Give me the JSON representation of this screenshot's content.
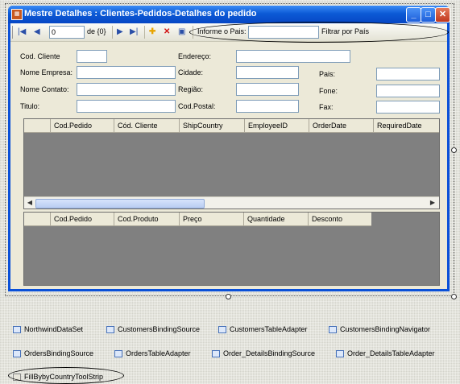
{
  "window": {
    "title": "Mestre Detalhes : Clientes-Pedidos-Detalhes do pedido"
  },
  "titlebar_buttons": {
    "minimize": "_",
    "maximize": "□",
    "close": "✕"
  },
  "toolbar": {
    "position_value": "0",
    "count_label": "de {0}",
    "country_label": "Informe o Pais:",
    "country_value": "",
    "filter_button": "Filtrar por País"
  },
  "form": {
    "cod_cliente": "Cod. Cliente",
    "nome_empresa": "Nome Empresa:",
    "nome_contato": "Nome Contato:",
    "titulo": "Titulo:",
    "endereco": "Endereço:",
    "cidade": "Cidade:",
    "regiao": "Região:",
    "cod_postal": "Cod.Postal:",
    "pais": "Pais:",
    "fone": "Fone:",
    "fax": "Fax:"
  },
  "orders_grid": {
    "columns": [
      "Cod.Pedido",
      "Cód. Cliente",
      "ShipCountry",
      "EmployeeID",
      "OrderDate",
      "RequiredDate"
    ]
  },
  "details_grid": {
    "columns": [
      "Cod.Pedido",
      "Cod.Produto",
      "Preço",
      "Quantidade",
      "Desconto"
    ]
  },
  "component_tray": [
    "NorthwindDataSet",
    "CustomersBindingSource",
    "CustomersTableAdapter",
    "CustomersBindingNavigator",
    "OrdersBindingSource",
    "OrdersTableAdapter",
    "Order_DetailsBindingSource",
    "Order_DetailsTableAdapter",
    "FillBybyCountryToolStrip"
  ],
  "colors": {
    "titlebar": "#0c5ad6",
    "grid_body": "#808080",
    "form_bg": "#ece9d8"
  }
}
